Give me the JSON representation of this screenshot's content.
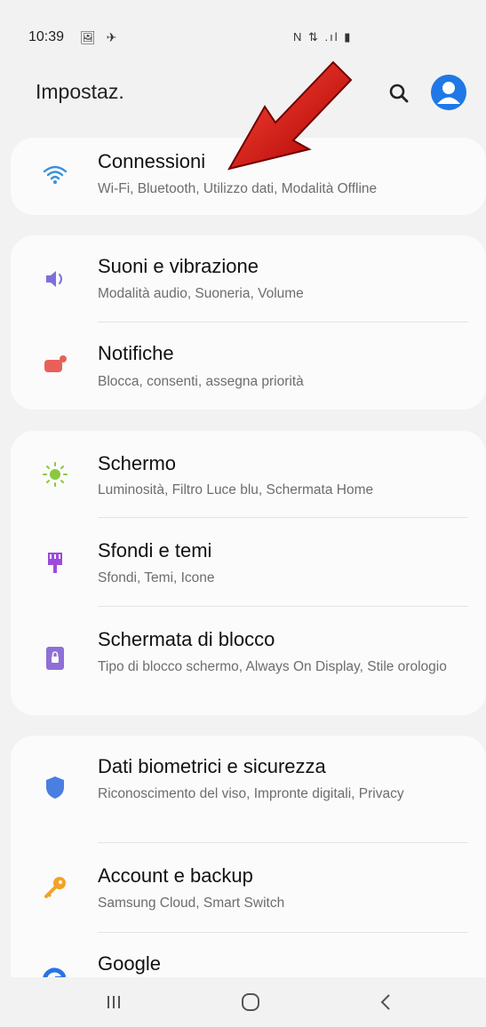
{
  "status_bar": {
    "time": "10:39",
    "left_icons": "🖼 ✈",
    "right_icons": "N ⇅ .ıl ▮"
  },
  "header": {
    "title": "Impostaz.",
    "search_icon": "search-icon",
    "profile_icon": "profile-icon",
    "accent_color": "#1f78e6"
  },
  "sections": [
    {
      "items": [
        {
          "title": "Connessioni",
          "subtitle": "Wi-Fi, Bluetooth, Utilizzo dati, Modalità Offline",
          "icon": "wifi-icon",
          "color": "#3a8fd9"
        }
      ]
    },
    {
      "items": [
        {
          "title": "Suoni e vibrazione",
          "subtitle": "Modalità audio, Suoneria, Volume",
          "icon": "sound-icon",
          "color": "#7b6fe0"
        },
        {
          "title": "Notifiche",
          "subtitle": "Blocca, consenti, assegna priorità",
          "icon": "notification-icon",
          "color": "#e9605a"
        }
      ]
    },
    {
      "items": [
        {
          "title": "Schermo",
          "subtitle": "Luminosità, Filtro Luce blu, Schermata Home",
          "icon": "brightness-icon",
          "color": "#8bc83f"
        },
        {
          "title": "Sfondi e temi",
          "subtitle": "Sfondi, Temi, Icone",
          "icon": "brush-icon",
          "color": "#9b4bdc"
        },
        {
          "title": "Schermata di blocco",
          "subtitle": "Tipo di blocco schermo, Always On Display, Stile orologio",
          "icon": "lock-icon",
          "color": "#8e6fd6"
        }
      ]
    },
    {
      "items": [
        {
          "title": "Dati biometrici e sicurezza",
          "subtitle": "Riconoscimento del viso, Impronte digitali, Privacy",
          "icon": "shield-icon",
          "color": "#4a7ee0"
        },
        {
          "title": "Account e backup",
          "subtitle": "Samsung Cloud, Smart Switch",
          "icon": "key-icon",
          "color": "#f2a325"
        },
        {
          "title": "Google",
          "subtitle": "",
          "icon": "google-icon",
          "color": "#2a72e8"
        }
      ]
    }
  ],
  "nav_bar": {
    "recents_icon": "recents-icon",
    "home_icon": "home-icon",
    "back_icon": "back-icon"
  }
}
